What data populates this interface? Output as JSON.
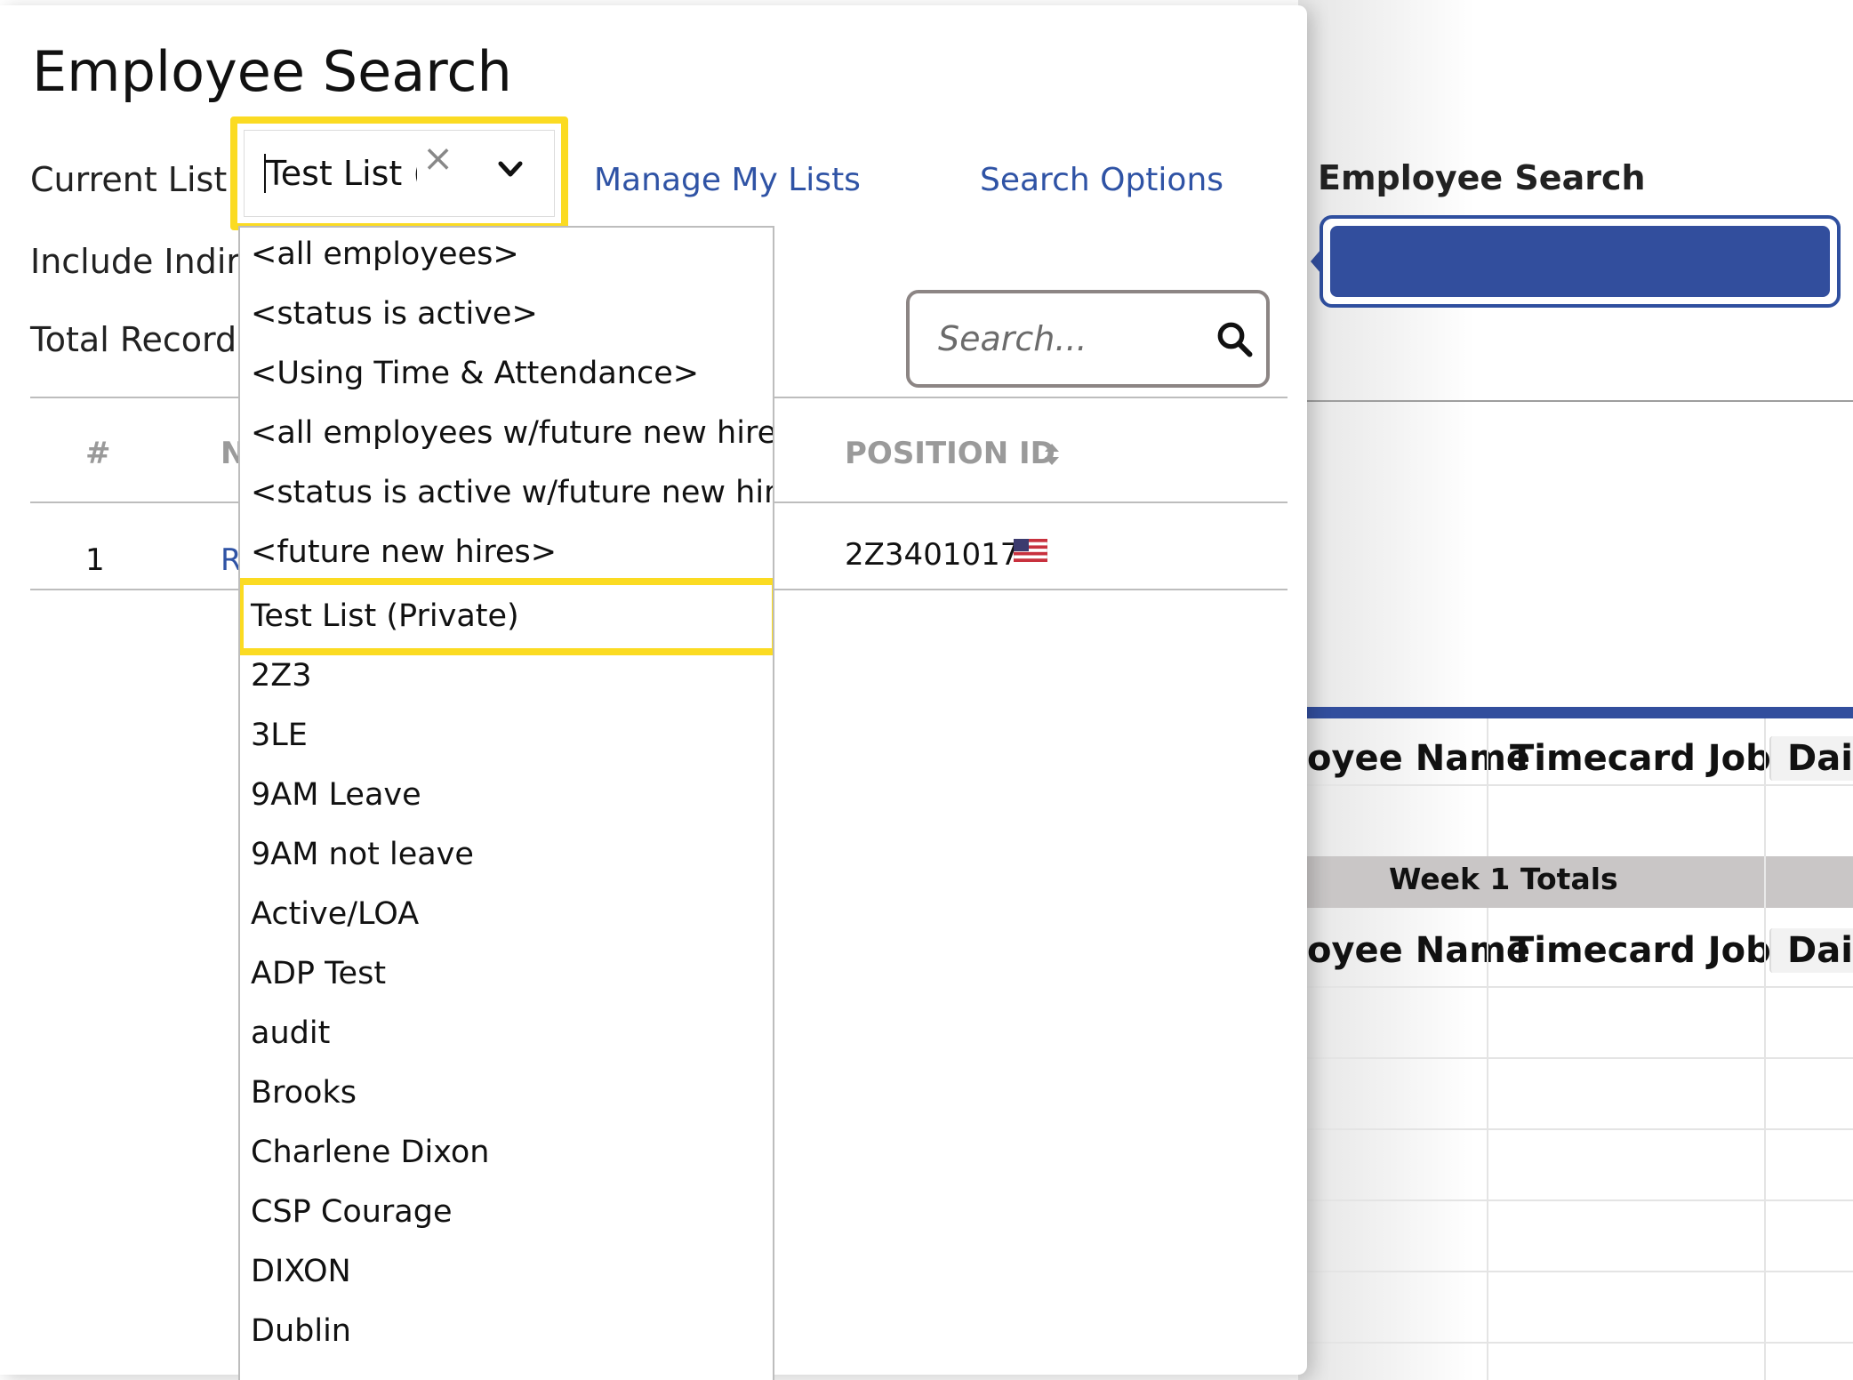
{
  "background_panel": {
    "title": "Employee Search",
    "table_headers": [
      {
        "label": "oyee Name"
      },
      {
        "label": "Timecard Job"
      },
      {
        "label": "Dail"
      }
    ],
    "week_totals_label": "Week 1 Totals",
    "table_headers_2": [
      {
        "label": "oyee Name"
      },
      {
        "label": "Timecard Job"
      },
      {
        "label": "Dail"
      }
    ],
    "accent_color": "#324e9d"
  },
  "modal": {
    "title": "Employee Search",
    "current_list_label": "Current List",
    "current_list_value": "Test List (Private)",
    "include_label": "Include Indire",
    "total_records_label": "Total Records",
    "manage_link": "Manage My Lists",
    "search_options_link": "Search Options",
    "search_placeholder": "Search...",
    "columns": {
      "num": "#",
      "name": "N",
      "position_id": "POSITION ID"
    },
    "rows": [
      {
        "num": "1",
        "name": "R",
        "position_id": "2Z3401017",
        "flag_icon": "us-flag-icon"
      }
    ],
    "highlight_color": "#fbdb22",
    "link_color": "#2f53a5"
  },
  "dropdown": {
    "options": [
      "<all employees>",
      "<status is active>",
      "<Using Time & Attendance>",
      "<all employees w/future new hires>",
      "<status is active w/future new hires>",
      "<future new hires>",
      "Test List (Private)",
      "2Z3",
      "3LE",
      "9AM Leave",
      "9AM not leave",
      "Active/LOA",
      "ADP Test",
      "audit",
      "Brooks",
      "Charlene Dixon",
      "CSP Courage",
      "DIXON",
      "Dublin"
    ],
    "highlighted_option": "Test List (Private)"
  }
}
